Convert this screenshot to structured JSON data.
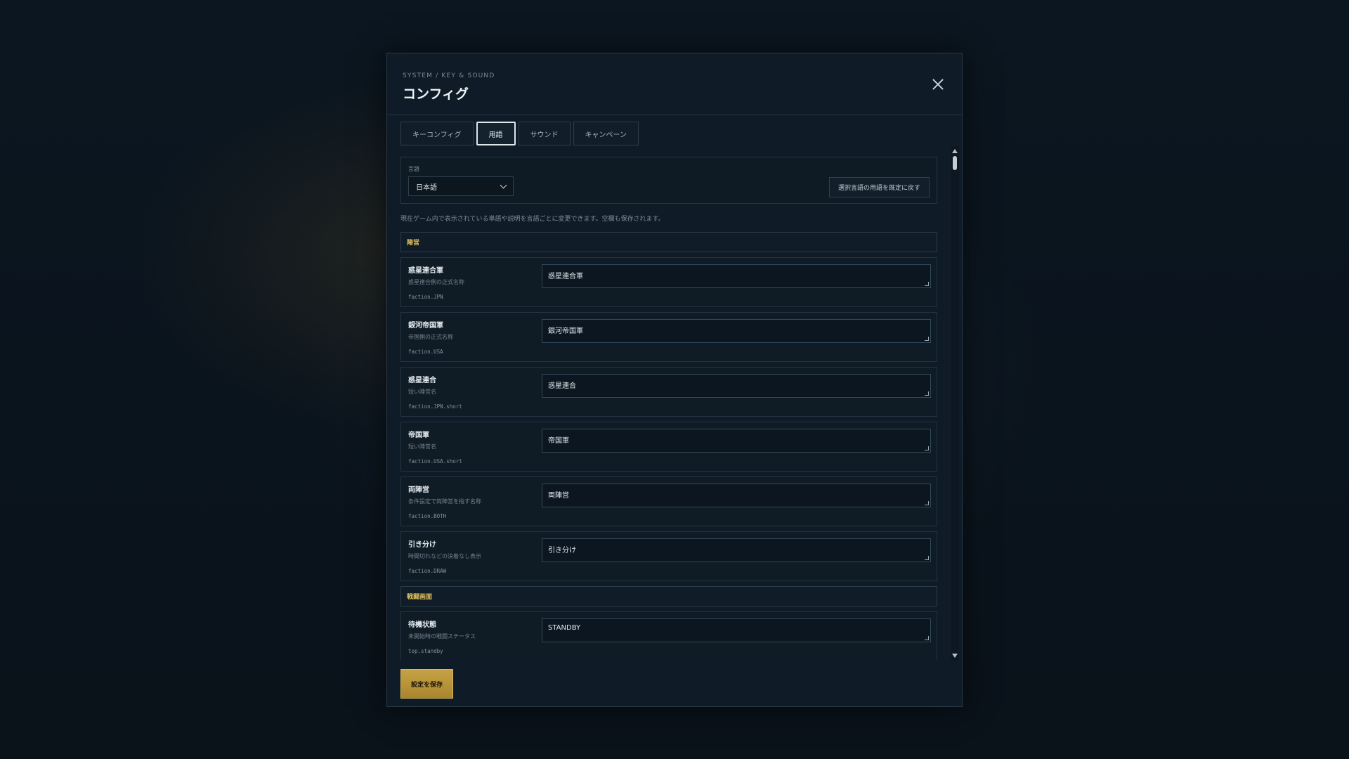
{
  "header": {
    "breadcrumb": "SYSTEM / KEY & SOUND",
    "title": "コンフィグ"
  },
  "tabs": [
    {
      "label": "キーコンフィグ",
      "active": false
    },
    {
      "label": "用語",
      "active": true
    },
    {
      "label": "サウンド",
      "active": false
    },
    {
      "label": "キャンペーン",
      "active": false
    }
  ],
  "language": {
    "label": "言語",
    "selected": "日本語",
    "reset_label": "選択言語の用語を既定に戻す"
  },
  "help_text": "現在ゲーム内で表示されている単語や説明を言語ごとに変更できます。空欄も保存されます。",
  "sections": [
    {
      "title": "陣営",
      "terms": [
        {
          "name": "惑星連合軍",
          "desc": "惑星連合側の正式名称",
          "key": "faction.JPN",
          "value": "惑星連合軍"
        },
        {
          "name": "銀河帝国軍",
          "desc": "帝国側の正式名称",
          "key": "faction.USA",
          "value": "銀河帝国軍"
        },
        {
          "name": "惑星連合",
          "desc": "短い陣営名",
          "key": "faction.JPN.short",
          "value": "惑星連合"
        },
        {
          "name": "帝国軍",
          "desc": "短い陣営名",
          "key": "faction.USA.short",
          "value": "帝国軍"
        },
        {
          "name": "両陣営",
          "desc": "条件設定で両陣営を指す名称",
          "key": "faction.BOTH",
          "value": "両陣営"
        },
        {
          "name": "引き分け",
          "desc": "時間切れなどの決着なし表示",
          "key": "faction.DRAW",
          "value": "引き分け"
        }
      ]
    },
    {
      "title": "戦闘画面",
      "terms": [
        {
          "name": "待機状態",
          "desc": "未開始時の戦闘ステータス",
          "key": "top.standby",
          "value": "STANDBY"
        }
      ]
    }
  ],
  "footer": {
    "save_label": "設定を保存"
  },
  "colors": {
    "accent_gold": "#e2c15a",
    "save_button": "#b8932f",
    "panel_bg": "#0f1c27"
  }
}
